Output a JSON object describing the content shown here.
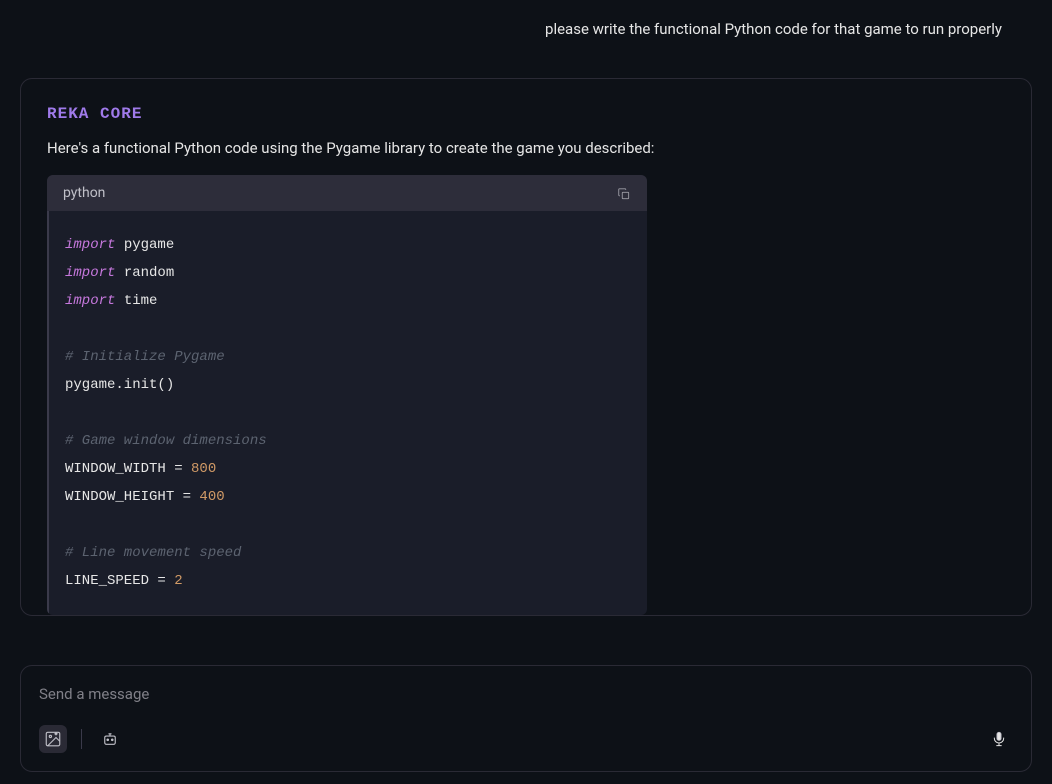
{
  "user_message": "please write the functional Python code for that game to run properly",
  "assistant": {
    "model_name": "REKA CORE",
    "intro": "Here's a functional Python code using the Pygame library to create the game you described:",
    "code_lang": "python",
    "code": {
      "l1_kw": "import",
      "l1_mod": " pygame",
      "l2_kw": "import",
      "l2_mod": " random",
      "l3_kw": "import",
      "l3_mod": " time",
      "l5_comment": "# Initialize Pygame",
      "l6": "pygame.init()",
      "l8_comment": "# Game window dimensions",
      "l9_a": "WINDOW_WIDTH = ",
      "l9_b": "800",
      "l10_a": "WINDOW_HEIGHT = ",
      "l10_b": "400",
      "l12_comment": "# Line movement speed",
      "l13_a": "LINE_SPEED = ",
      "l13_b": "2"
    }
  },
  "input": {
    "placeholder": "Send a message"
  }
}
